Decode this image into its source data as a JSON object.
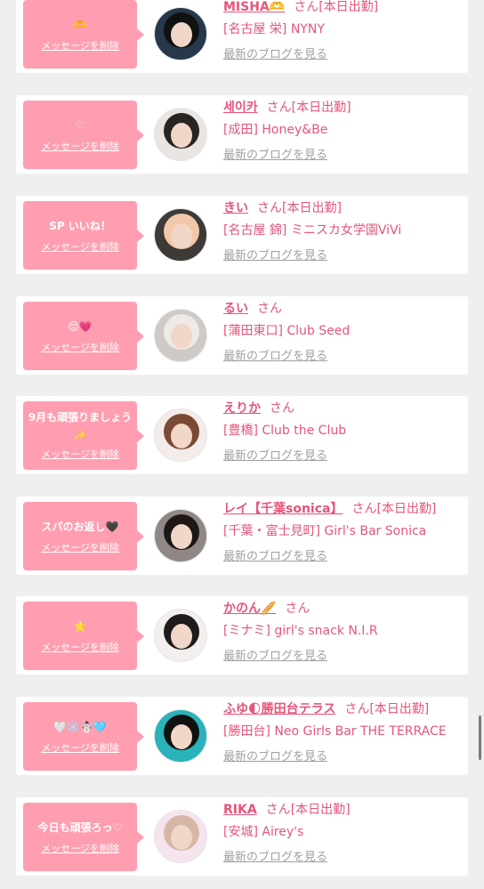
{
  "items": [
    {
      "message": "🫶",
      "delete_label": "メッセージを削除",
      "name": "MISHA🫶",
      "san": "さん",
      "status": "[本日出勤]",
      "shop": "[名古屋 栄] NYNY",
      "blog_label": "最新のブログを見る",
      "avatar_colors": {
        "bg": "#26384a",
        "hair": "#111111"
      }
    },
    {
      "message": "♡",
      "delete_label": "メッセージを削除",
      "name": "세이카",
      "san": "さん",
      "status": "[本日出勤]",
      "shop": "[成田] Honey&Be",
      "blog_label": "最新のブログを見る",
      "avatar_colors": {
        "bg": "#e9e5e2",
        "hair": "#2a2422"
      }
    },
    {
      "message": "SP いいね！",
      "delete_label": "メッセージを削除",
      "name": "きい",
      "san": "さん",
      "status": "[本日出勤]",
      "shop": "[名古屋 錦] ミニスカ女学園ViVi",
      "blog_label": "最新のブログを見る",
      "avatar_colors": {
        "bg": "#3d3a38",
        "hair": "#f1c8a8"
      }
    },
    {
      "message": "😔💗",
      "delete_label": "メッセージを削除",
      "name": "るい",
      "san": "さん",
      "status": "",
      "shop": "[蒲田東口] Club Seed",
      "blog_label": "最新のブログを見る",
      "avatar_colors": {
        "bg": "#cfc9c8",
        "hair": "#efeae6"
      }
    },
    {
      "message": "9月も頑張りましょう✨",
      "delete_label": "メッセージを削除",
      "name": "えりか",
      "san": "さん",
      "status": "",
      "shop": "[豊橋] Club the Club",
      "blog_label": "最新のブログを見る",
      "avatar_colors": {
        "bg": "#f4ece8",
        "hair": "#7a4a35"
      }
    },
    {
      "message": "スパのお返し🖤",
      "delete_label": "メッセージを削除",
      "name": "レイ【千葉sonica】",
      "san": "さん",
      "status": "[本日出勤]",
      "shop": "[千葉・富士見町] Girl's Bar Sonica",
      "blog_label": "最新のブログを見る",
      "avatar_colors": {
        "bg": "#8f8886",
        "hair": "#1d1716"
      }
    },
    {
      "message": "⭐",
      "delete_label": "メッセージを削除",
      "name": "かのん🥖",
      "san": "さん",
      "status": "",
      "shop": "[ミナミ] girl's snack N.I.R",
      "blog_label": "最新のブログを見る",
      "avatar_colors": {
        "bg": "#f2efee",
        "hair": "#1f1b1a"
      }
    },
    {
      "message": "🤍❄️☃️🩵",
      "delete_label": "メッセージを削除",
      "name": "ふゆ🌓勝田台テラス",
      "san": "さん",
      "status": "[本日出勤]",
      "shop": "[勝田台] Neo Girls Bar THE TERRACE",
      "blog_label": "最新のブログを見る",
      "avatar_colors": {
        "bg": "#2ab3b8",
        "hair": "#111111"
      }
    },
    {
      "message": "今日も頑張ろっ♡",
      "delete_label": "メッセージを削除",
      "name": "RIKA",
      "san": "さん",
      "status": "[本日出勤]",
      "shop": "[安城] Airey's",
      "blog_label": "最新のブログを見る",
      "avatar_colors": {
        "bg": "#f5e4ee",
        "hair": "#d6b7a5"
      }
    }
  ]
}
